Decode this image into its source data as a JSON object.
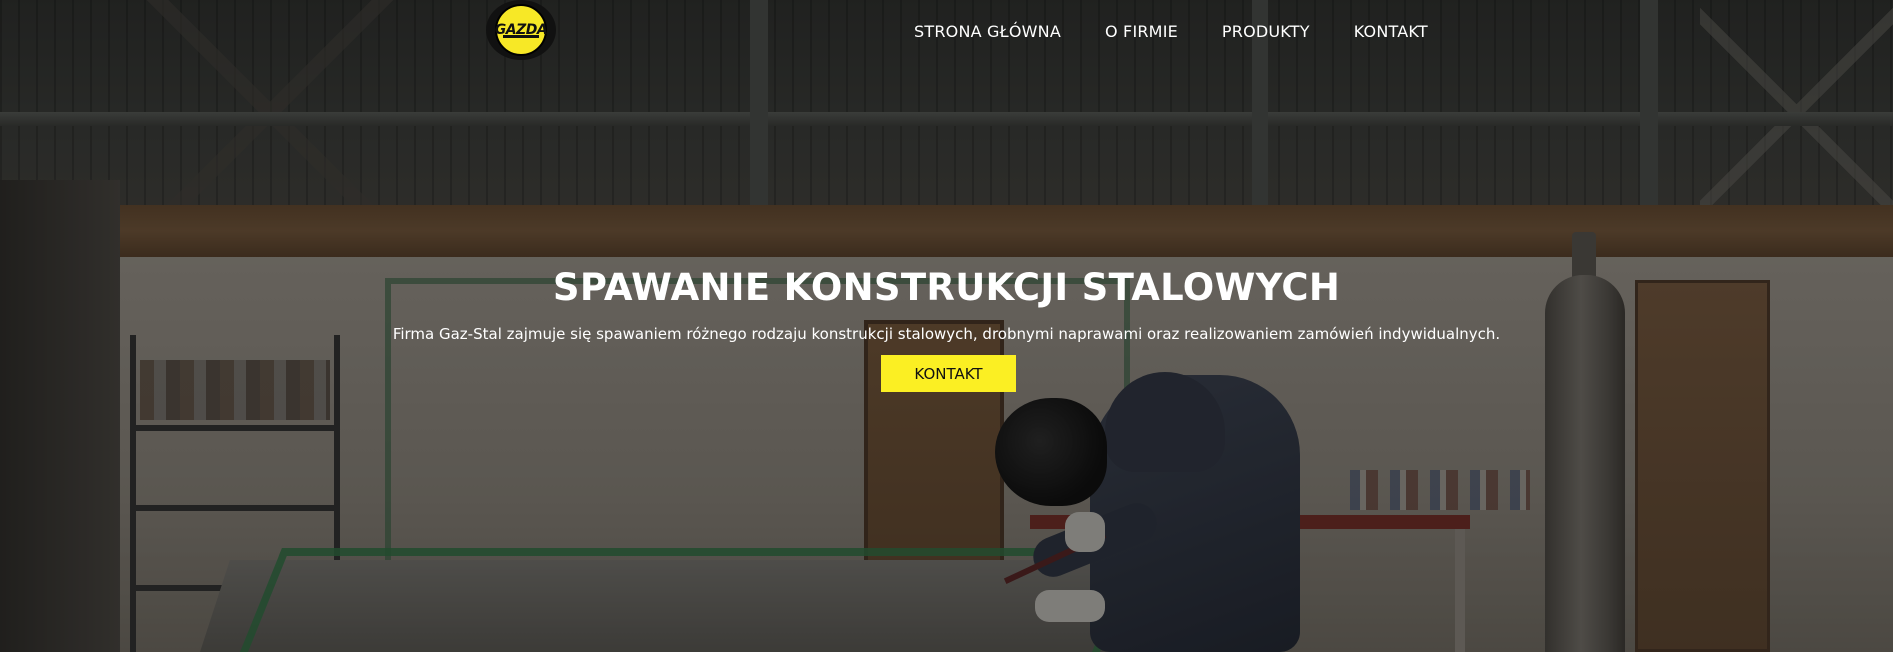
{
  "logo": {
    "text": "GAZDA"
  },
  "nav": {
    "items": [
      {
        "label": "STRONA GŁÓWNA"
      },
      {
        "label": "O FIRMIE"
      },
      {
        "label": "PRODUKTY"
      },
      {
        "label": "KONTAKT"
      }
    ]
  },
  "hero": {
    "title": "SPAWANIE KONSTRUKCJI STALOWYCH",
    "subtitle": "Firma Gaz-Stal zajmuje się spawaniem różnego rodzaju konstrukcji stalowych, drobnymi naprawami oraz realizowaniem zamówień indywidualnych.",
    "button_label": "KONTAKT"
  },
  "colors": {
    "accent": "#fbef23",
    "overlay": "#000000",
    "text": "#ffffff"
  }
}
